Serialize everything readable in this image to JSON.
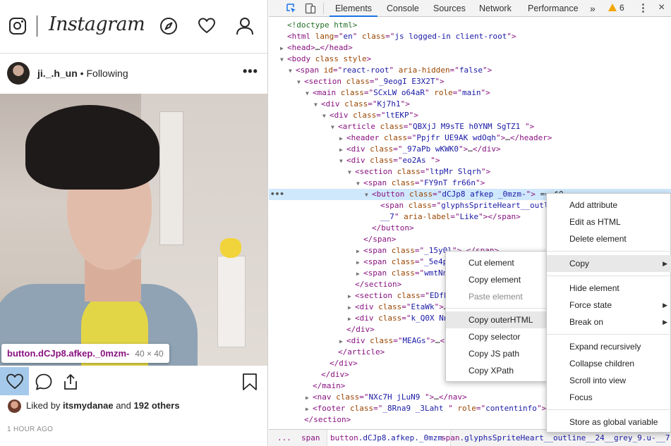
{
  "instagram": {
    "logo": "Instagram",
    "post": {
      "username": "ji._.h_un",
      "separator": " • ",
      "follow_status": "Following",
      "more": "•••",
      "liked_prefix": "Liked by ",
      "liked_user": "itsmydanae",
      "liked_mid": " and ",
      "liked_count": "192 others",
      "time_ago": "1 HOUR AGO"
    },
    "inspect_tooltip": {
      "selector": "button.dCJp8.afkep._0mzm-",
      "size": "40 × 40"
    }
  },
  "devtools": {
    "tabs": [
      "Elements",
      "Console",
      "Sources",
      "Network",
      "Performance"
    ],
    "active_tab": "Elements",
    "more_tabs": "»",
    "warnings_count": "6",
    "menu_kebab": "⋮",
    "close": "×",
    "dom_lines": [
      {
        "indent": 0,
        "arrow": "",
        "html": "<span class='cm'>&lt;!doctype html&gt;</span>"
      },
      {
        "indent": 0,
        "arrow": "",
        "html": "<span class='tag'>&lt;html </span><span class='an'>lang</span><span class='tag'>=\"</span><span class='av'>en</span><span class='tag'>\" </span><span class='an'>class</span><span class='tag'>=\"</span><span class='av'>js logged-in client-root</span><span class='tag'>\"&gt;</span>"
      },
      {
        "indent": 0,
        "arrow": "c",
        "html": "<span class='tag'>&lt;head&gt;</span><span class='txt'>…</span><span class='tag'>&lt;/head&gt;</span>"
      },
      {
        "indent": 0,
        "arrow": "o",
        "html": "<span class='tag'>&lt;body </span><span class='an'>class style</span><span class='tag'>&gt;</span>"
      },
      {
        "indent": 1,
        "arrow": "o",
        "html": "<span class='tag'>&lt;span </span><span class='an'>id</span><span class='tag'>=\"</span><span class='av'>react-root</span><span class='tag'>\" </span><span class='an'>aria-hidden</span><span class='tag'>=\"</span><span class='av'>false</span><span class='tag'>\"&gt;</span>"
      },
      {
        "indent": 2,
        "arrow": "o",
        "html": "<span class='tag'>&lt;section </span><span class='an'>class</span><span class='tag'>=\"</span><span class='av'>_9eogI E3X2T</span><span class='tag'>\"&gt;</span>"
      },
      {
        "indent": 3,
        "arrow": "o",
        "html": "<span class='tag'>&lt;main </span><span class='an'>class</span><span class='tag'>=\"</span><span class='av'>SCxLW  o64aR</span><span class='tag'>\" </span><span class='an'>role</span><span class='tag'>=\"</span><span class='av'>main</span><span class='tag'>\"&gt;</span>"
      },
      {
        "indent": 4,
        "arrow": "o",
        "html": "<span class='tag'>&lt;div </span><span class='an'>class</span><span class='tag'>=\"</span><span class='av'>Kj7h1</span><span class='tag'>\"&gt;</span>"
      },
      {
        "indent": 5,
        "arrow": "o",
        "html": "<span class='tag'>&lt;div </span><span class='an'>class</span><span class='tag'>=\"</span><span class='av'>ltEKP</span><span class='tag'>\"&gt;</span>"
      },
      {
        "indent": 6,
        "arrow": "o",
        "html": "<span class='tag'>&lt;article </span><span class='an'>class</span><span class='tag'>=\"</span><span class='av'>QBXjJ M9sTE h0YNM  SgTZ1    </span><span class='tag'>\"&gt;</span>"
      },
      {
        "indent": 7,
        "arrow": "c",
        "html": "<span class='tag'>&lt;header </span><span class='an'>class</span><span class='tag'>=\"</span><span class='av'>Ppjfr UE9AK  wdOqh</span><span class='tag'>\"&gt;</span><span class='txt'>…</span><span class='tag'>&lt;/header&gt;</span>"
      },
      {
        "indent": 7,
        "arrow": "c",
        "html": "<span class='tag'>&lt;div </span><span class='an'>class</span><span class='tag'>=\"</span><span class='av'>_97aPb wKWK0</span><span class='tag'>\"&gt;</span><span class='txt'>…</span><span class='tag'>&lt;/div&gt;</span>"
      },
      {
        "indent": 7,
        "arrow": "o",
        "html": "<span class='tag'>&lt;div </span><span class='an'>class</span><span class='tag'>=\"</span><span class='av'>eo2As </span><span class='tag'>\"&gt;</span>"
      },
      {
        "indent": 8,
        "arrow": "o",
        "html": "<span class='tag'>&lt;section </span><span class='an'>class</span><span class='tag'>=\"</span><span class='av'>ltpMr Slqrh</span><span class='tag'>\"&gt;</span>"
      },
      {
        "indent": 9,
        "arrow": "o",
        "html": "<span class='tag'>&lt;span </span><span class='an'>class</span><span class='tag'>=\"</span><span class='av'>FY9nT fr66n</span><span class='tag'>\"&gt;</span>"
      },
      {
        "indent": 10,
        "arrow": "o",
        "hl": true,
        "html": "<span class='tag'>&lt;button </span><span class='an'>class</span><span class='tag'>=\"</span><span class='av'>dCJp8 afkep _0mzm-</span><span class='tag'>\"&gt;</span><span class='txt'> == $0</span>"
      },
      {
        "indent": 11,
        "arrow": "",
        "html": "<span class='tag'>&lt;span </span><span class='an'>class</span><span class='tag'>=\"</span><span class='av'>glyphsSpriteHeart__outline__24__grey_9 u-</span>"
      },
      {
        "indent": 11,
        "arrow": "",
        "html": "<span class='av'>__7</span><span class='tag'>\" </span><span class='an'>aria-label</span><span class='tag'>=\"</span><span class='av'>Like</span><span class='tag'>\"&gt;&lt;/span&gt;</span>"
      },
      {
        "indent": 10,
        "arrow": "",
        "html": "<span class='tag'>&lt;/button&gt;</span>"
      },
      {
        "indent": 9,
        "arrow": "",
        "html": "<span class='tag'>&lt;/span&gt;</span>"
      },
      {
        "indent": 9,
        "arrow": "c",
        "html": "<span class='tag'>&lt;span </span><span class='an'>class</span><span class='tag'>=\"</span><span class='av'>_15y0l</span><span class='tag'>\"&gt;</span><span class='txt'>…</span><span class='tag'>&lt;/span&gt;</span>"
      },
      {
        "indent": 9,
        "arrow": "c",
        "html": "<span class='tag'>&lt;span </span><span class='an'>class</span><span class='tag'>=\"</span><span class='av'>_5e4p</span><span class='tag'>\"&gt;</span><span class='txt'>…</span><span class='tag'>&lt;/span&gt;</span>"
      },
      {
        "indent": 9,
        "arrow": "c",
        "html": "<span class='tag'>&lt;span </span><span class='an'>class</span><span class='tag'>=\"</span><span class='av'>wmtNn</span><span class='tag'>\"&gt;</span><span class='txt'>…</span><span class='tag'>&lt;/span&gt;</span>"
      },
      {
        "indent": 8,
        "arrow": "",
        "html": "<span class='tag'>&lt;/section&gt;</span>"
      },
      {
        "indent": 8,
        "arrow": "c",
        "html": "<span class='tag'>&lt;section </span><span class='an'>class</span><span class='tag'>=\"</span><span class='av'>EDfFK ygqzn</span><span class='tag'>\"&gt;</span><span class='txt'>…</span><span class='tag'>&lt;/section&gt;</span>"
      },
      {
        "indent": 8,
        "arrow": "c",
        "html": "<span class='tag'>&lt;div </span><span class='an'>class</span><span class='tag'>=\"</span><span class='av'>EtaWk</span><span class='tag'>\"&gt;</span><span class='txt'>…</span><span class='tag'>&lt;/div&gt;</span>"
      },
      {
        "indent": 8,
        "arrow": "c",
        "html": "<span class='tag'>&lt;div </span><span class='an'>class</span><span class='tag'>=\"</span><span class='av'>k_Q0X NnvRN</span><span class='tag'>\"&gt;</span><span class='txt'>…</span><span class='tag'>&lt;/div&gt;</span>"
      },
      {
        "indent": 7,
        "arrow": "",
        "html": "<span class='tag'>&lt;/div&gt;</span>"
      },
      {
        "indent": 7,
        "arrow": "c",
        "html": "<span class='tag'>&lt;div </span><span class='an'>class</span><span class='tag'>=\"</span><span class='av'>MEAGs</span><span class='tag'>\"&gt;</span><span class='txt'>…</span><span class='tag'>&lt;/div&gt;</span>"
      },
      {
        "indent": 6,
        "arrow": "",
        "html": "<span class='tag'>&lt;/article&gt;</span>"
      },
      {
        "indent": 5,
        "arrow": "",
        "html": "<span class='tag'>&lt;/div&gt;</span>"
      },
      {
        "indent": 4,
        "arrow": "",
        "html": "<span class='tag'>&lt;/div&gt;</span>"
      },
      {
        "indent": 3,
        "arrow": "",
        "html": "<span class='tag'>&lt;/main&gt;</span>"
      },
      {
        "indent": 3,
        "arrow": "c",
        "html": "<span class='tag'>&lt;nav </span><span class='an'>class</span><span class='tag'>=\"</span><span class='av'>NXc7H jLuN9  </span><span class='tag'>\"&gt;</span><span class='txt'>…</span><span class='tag'>&lt;/nav&gt;</span>"
      },
      {
        "indent": 3,
        "arrow": "c",
        "html": "<span class='tag'>&lt;footer </span><span class='an'>class</span><span class='tag'>=\"</span><span class='av'>_8Rna9  _3Laht </span><span class='tag'>\" </span><span class='an'>role</span><span class='tag'>=\"</span><span class='av'>contentinfo</span><span class='tag'>\"&gt;</span><span class='txt'>…</span><span class='tag'>&lt;/footer&gt;</span>"
      },
      {
        "indent": 2,
        "arrow": "",
        "html": "<span class='tag'>&lt;/section&gt;</span>"
      },
      {
        "indent": 1,
        "arrow": "",
        "html": "<span class='tag'>&lt;/span&gt;</span>"
      }
    ],
    "breadcrumbs": [
      {
        "tag": "...",
        "cls": ""
      },
      {
        "tag": "span",
        "cls": ""
      },
      {
        "tag": "button",
        "cls": ".dCJp8.afkep._0mzm-",
        "current": true
      },
      {
        "tag": "span",
        "cls": ".glyphsSpriteHeart__outline__24__grey_9.u-__7"
      }
    ]
  },
  "context_menu": {
    "items": [
      {
        "label": "Add attribute"
      },
      {
        "label": "Edit as HTML"
      },
      {
        "label": "Delete element"
      },
      {
        "sep": true
      },
      {
        "label": "Copy",
        "submenu": true,
        "active": true
      },
      {
        "sep": true
      },
      {
        "label": "Hide element"
      },
      {
        "label": "Force state",
        "submenu": true
      },
      {
        "label": "Break on",
        "submenu": true
      },
      {
        "sep": true
      },
      {
        "label": "Expand recursively"
      },
      {
        "label": "Collapse children"
      },
      {
        "label": "Scroll into view"
      },
      {
        "label": "Focus"
      },
      {
        "sep": true
      },
      {
        "label": "Store as global variable"
      }
    ]
  },
  "copy_submenu": {
    "items": [
      {
        "label": "Cut element"
      },
      {
        "label": "Copy element"
      },
      {
        "label": "Paste element",
        "disabled": true
      },
      {
        "sep": true
      },
      {
        "label": "Copy outerHTML",
        "active": true
      },
      {
        "label": "Copy selector"
      },
      {
        "label": "Copy JS path"
      },
      {
        "label": "Copy XPath"
      }
    ]
  }
}
